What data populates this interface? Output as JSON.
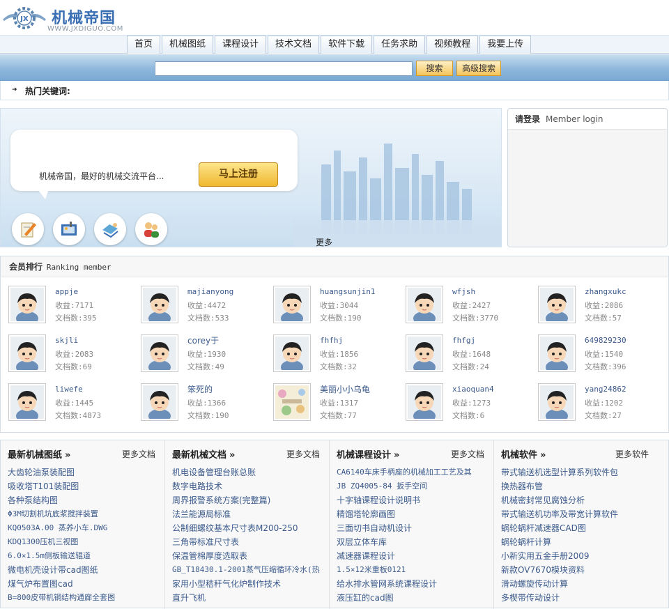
{
  "header": {
    "logo_badge": "JX",
    "logo_name": "机械帝国",
    "logo_url": "WWW.JXDIGUO.COM"
  },
  "nav": {
    "tabs": [
      "首页",
      "机械图纸",
      "课程设计",
      "技术文档",
      "软件下载",
      "任务求助",
      "视频教程",
      "我要上传"
    ]
  },
  "search": {
    "value": "",
    "search_label": "搜索",
    "advanced_label": "高级搜索"
  },
  "hot": {
    "label": "热门关键词:"
  },
  "banner": {
    "slogan": "机械帝国，最好的机械交流平台...",
    "register_label": "马上注册",
    "more_label": "更多",
    "icons": [
      "document-pen-icon",
      "photo-tools-icon",
      "puzzle-hand-icon",
      "users-group-icon"
    ]
  },
  "login": {
    "title_cn": "请登录",
    "title_en": "Member login"
  },
  "ranking": {
    "title_cn": "会员排行",
    "title_en": "Ranking member",
    "members": [
      {
        "name": "appje",
        "income": "收益:7171",
        "docs": "文档数:395"
      },
      {
        "name": "majianyong",
        "income": "收益:4472",
        "docs": "文档数:533"
      },
      {
        "name": "huangsunjin1",
        "income": "收益:3044",
        "docs": "文档数:190"
      },
      {
        "name": "wfjsh",
        "income": "收益:2427",
        "docs": "文档数:3770"
      },
      {
        "name": "zhangxukc",
        "income": "收益:2086",
        "docs": "文档数:57"
      },
      {
        "name": "skjli",
        "income": "收益:2083",
        "docs": "文档数:69"
      },
      {
        "name": "corey于",
        "income": "收益:1930",
        "docs": "文档数:49"
      },
      {
        "name": "fhfhj",
        "income": "收益:1856",
        "docs": "文档数:32"
      },
      {
        "name": "fhfgj",
        "income": "收益:1648",
        "docs": "文档数:24"
      },
      {
        "name": "649829230",
        "income": "收益:1540",
        "docs": "文档数:396"
      },
      {
        "name": "liwefe",
        "income": "收益:1445",
        "docs": "文档数:4873"
      },
      {
        "name": "笨死的",
        "income": "收益:1366",
        "docs": "文档数:190"
      },
      {
        "name": "美丽小小乌龟",
        "income": "收益:1317",
        "docs": "文档数:77"
      },
      {
        "name": "xiaoquan4",
        "income": "收益:1273",
        "docs": "文档数:6"
      },
      {
        "name": "yang24862",
        "income": "收益:1202",
        "docs": "文档数:27"
      }
    ]
  },
  "columns": [
    {
      "title": "最新机械图纸",
      "more": "更多文档",
      "items": [
        "大齿轮油泵装配图",
        "吸收塔T101装配图",
        "各种泵结构图",
        "Φ3M切割机坑底浆搅拌装置",
        "KQ0503A.00 蒸养小车.DWG",
        "KDQ1300压机三视图",
        "6.0×1.5m侧板输送辊道",
        "微电机壳设计带cad图纸",
        "煤气炉布置图cad",
        "B=800皮带机钢结构通廊全套图"
      ]
    },
    {
      "title": "最新机械文档",
      "more": "更多文档",
      "items": [
        "机电设备管理台账总账",
        "数字电路技术",
        "周界报警系统方案(完整篇)",
        "法兰能源局标准",
        "公制细螺纹基本尺寸表M200-250",
        "三角带标准尺寸表",
        "保温管棉厚度选取表",
        "GB_T18430.1-2001蒸气压缩循环冷水(热",
        "家用小型秸秆气化炉制作技术",
        "直升飞机"
      ]
    },
    {
      "title": "机械课程设计",
      "more": "更多文档",
      "items": [
        "CA6140车床手柄座的机械加工工艺及其",
        "JB ZQ4005-84 扳手空间",
        "十字轴课程设计说明书",
        "精馏塔轮廓画图",
        "三面切书自动机设计",
        "双层立体车库",
        "减速器课程设计",
        "1.5×12米重板0121",
        "给水排水管网系统课程设计",
        "液压缸的cad图"
      ]
    },
    {
      "title": "机械软件",
      "more": "更多软件",
      "items": [
        "带式输送机选型计算系列软件包",
        "换热器布管",
        "机械密封常见腐蚀分析",
        "带式输送机功率及带宽计算软件",
        "蜗轮蜗杆减速器CAD图",
        "蜗轮蜗杆计算",
        "小新实用五金手册2009",
        "新款OV7670模块资料",
        "滑动螺旋传动计算",
        "多楔带传动设计"
      ]
    }
  ]
}
